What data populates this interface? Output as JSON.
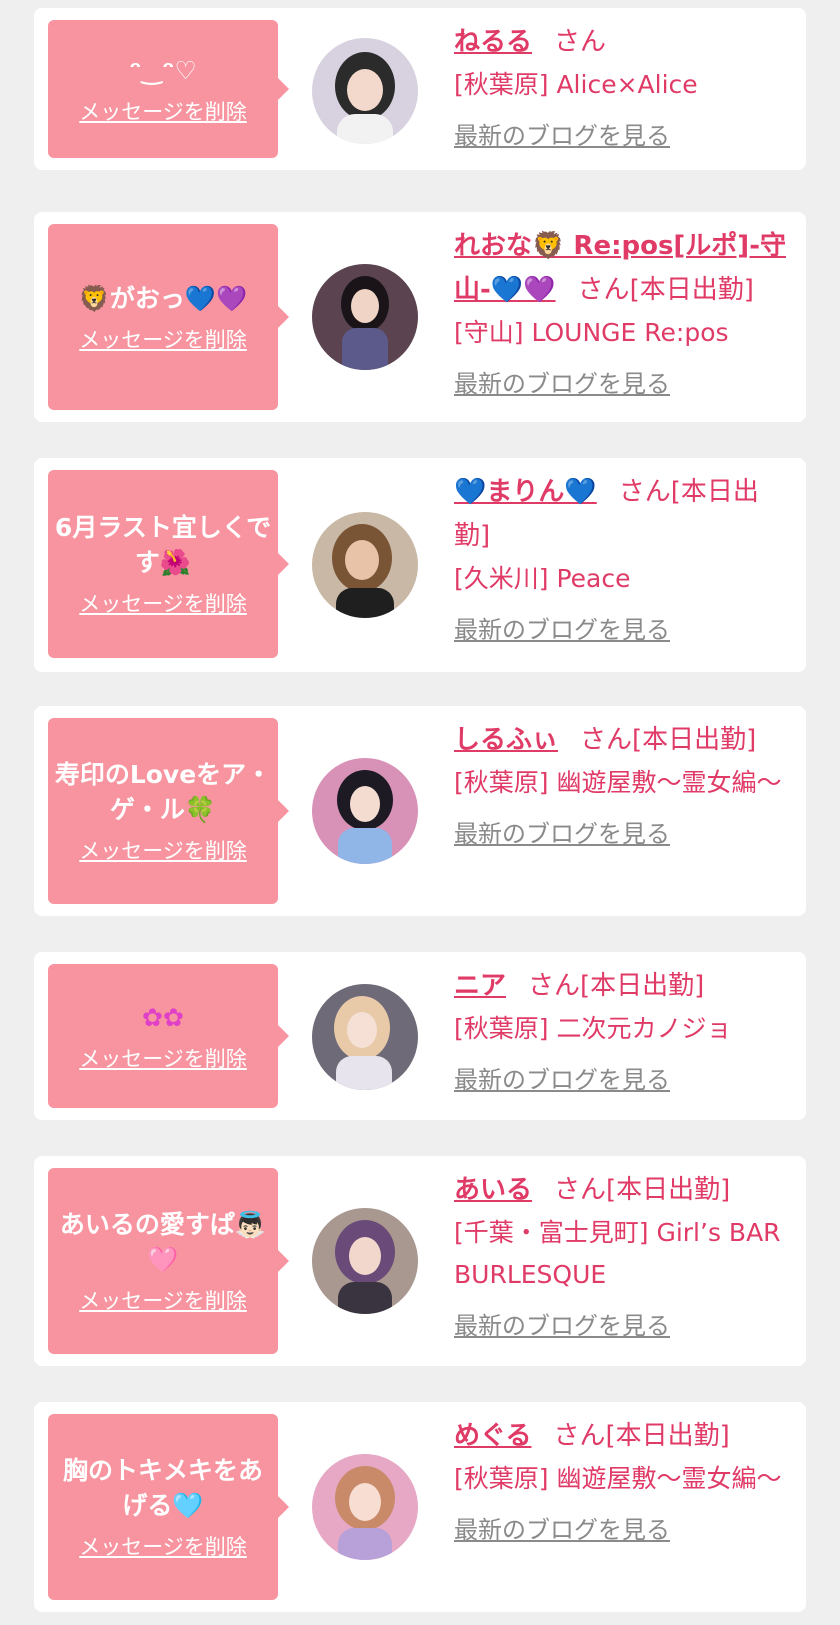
{
  "entries": [
    {
      "message": "ᵔ‿ᵔ♡",
      "delete_label": "メッセージを削除",
      "name": "ねるる",
      "honorific": "さん",
      "status": "",
      "shop": "[秋葉原] Alice×Alice",
      "blog_label": "最新のブログを見る",
      "colors": {
        "hair": "#2b2b2b",
        "bg": "#d8d2e0",
        "cloth": "#f2f2f2"
      }
    },
    {
      "message": "🦁がおっ💙💜",
      "delete_label": "メッセージを削除",
      "name": "れおな🦁 Re:pos[ルポ]-守山-💙💜",
      "honorific": "さん",
      "status": "[本日出勤]",
      "shop": "[守山] LOUNGE Re:pos",
      "blog_label": "最新のブログを見る",
      "colors": {
        "hair": "#1a1418",
        "bg": "#5b4350",
        "cloth": "#5c5a8a"
      }
    },
    {
      "message": "6月ラスト宜しくです🌺",
      "delete_label": "メッセージを削除",
      "name": "💙まりん💙",
      "honorific": "さん",
      "status": "[本日出勤]",
      "shop": "[久米川] Peace",
      "blog_label": "最新のブログを見る",
      "colors": {
        "hair": "#7a5535",
        "bg": "#c9b8a6",
        "cloth": "#1f1f1f"
      }
    },
    {
      "message": "寿印のLoveをア・ゲ・ル🍀",
      "delete_label": "メッセージを削除",
      "name": "しるふぃ",
      "honorific": "さん",
      "status": "[本日出勤]",
      "shop": "[秋葉原] 幽遊屋敷～霊女編～",
      "blog_label": "最新のブログを見る",
      "colors": {
        "hair": "#1d1a24",
        "bg": "#d892b8",
        "cloth": "#8fb6e6"
      }
    },
    {
      "message": "✿✿",
      "delete_label": "メッセージを削除",
      "name": "ニア",
      "honorific": "さん",
      "status": "[本日出勤]",
      "shop": "[秋葉原] 二次元カノジョ",
      "blog_label": "最新のブログを見る",
      "colors": {
        "hair": "#e8c9a8",
        "bg": "#6e6a78",
        "cloth": "#e8e4ee"
      }
    },
    {
      "message": "あいるの愛すぱ👼🏻🩷",
      "delete_label": "メッセージを削除",
      "name": "あいる",
      "honorific": "さん",
      "status": "[本日出勤]",
      "shop": "[千葉・富士見町] Girl’s BAR BURLESQUE",
      "blog_label": "最新のブログを見る",
      "colors": {
        "hair": "#6a4a78",
        "bg": "#a89890",
        "cloth": "#3a3440"
      }
    },
    {
      "message": "胸のトキメキをあげる🩵",
      "delete_label": "メッセージを削除",
      "name": "めぐる",
      "honorific": "さん",
      "status": "[本日出勤]",
      "shop": "[秋葉原] 幽遊屋敷～霊女編～",
      "blog_label": "最新のブログを見る",
      "colors": {
        "hair": "#c98a6a",
        "bg": "#e6a8c4",
        "cloth": "#b8a0d8"
      }
    }
  ]
}
